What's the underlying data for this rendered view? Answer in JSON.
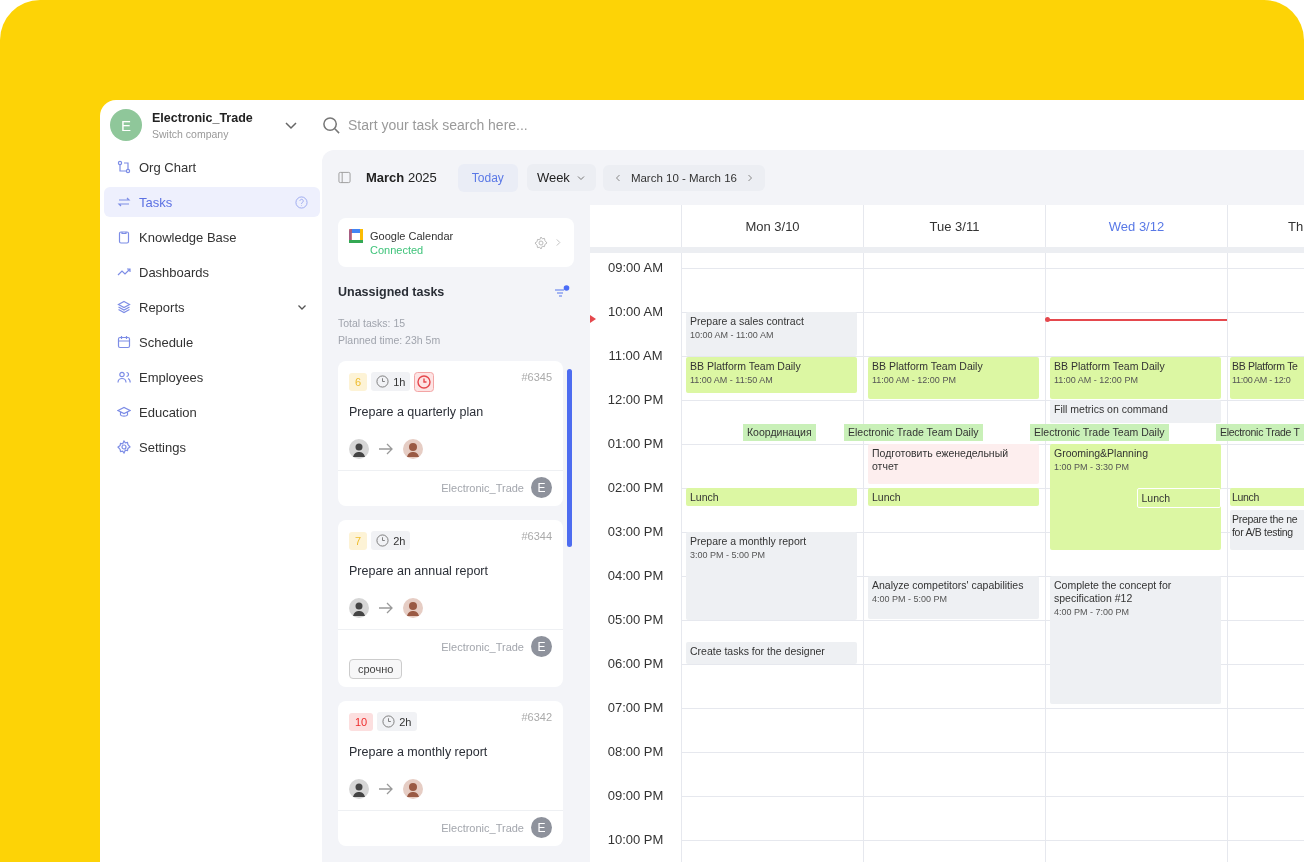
{
  "company": {
    "initial": "E",
    "name": "Electronic_Trade",
    "subtitle": "Switch company"
  },
  "nav": [
    {
      "label": "Org Chart",
      "kind": "org",
      "selected": false
    },
    {
      "label": "Tasks",
      "kind": "tasks",
      "selected": true,
      "help": true
    },
    {
      "label": "Knowledge Base",
      "kind": "book",
      "selected": false
    },
    {
      "label": "Dashboards",
      "kind": "trend",
      "selected": false
    },
    {
      "label": "Reports",
      "kind": "layers",
      "selected": false,
      "submenu": true
    },
    {
      "label": "Schedule",
      "kind": "calendar",
      "selected": false
    },
    {
      "label": "Employees",
      "kind": "people",
      "selected": false
    },
    {
      "label": "Education",
      "kind": "cap",
      "selected": false
    },
    {
      "label": "Settings",
      "kind": "gear",
      "selected": false
    }
  ],
  "search": {
    "placeholder": "Start your task search here..."
  },
  "toolbar": {
    "month": "**March** 2025",
    "today": "Today",
    "view": "Week",
    "range": "March 10 - March 16"
  },
  "integration": {
    "name": "Google Calendar",
    "status": "Connected"
  },
  "unassigned": {
    "title": "Unassigned tasks",
    "filter_active": true,
    "total": "Total tasks: 15",
    "planned": "Planned time: 23h 5m"
  },
  "tasks": [
    {
      "priority": "6",
      "color": "#fdf3d6",
      "duration": "1h",
      "overdue": true,
      "id": "#6345",
      "title": "Prepare a quarterly plan",
      "company": "Electronic_Trade",
      "company_initial": "E"
    },
    {
      "priority": "7",
      "color": "#fdf3d6",
      "duration": "2h",
      "overdue": false,
      "id": "#6344",
      "title": "Prepare an annual report",
      "company": "Electronic_Trade",
      "company_initial": "E",
      "tags": [
        "срочно"
      ]
    },
    {
      "priority": "10",
      "color": "#fcdfdf",
      "duration": "2h",
      "overdue": false,
      "id": "#6342",
      "title": "Prepare a monthly report",
      "company": "Electronic_Trade",
      "company_initial": "E"
    }
  ],
  "calendar": {
    "time_labels": [
      "09:00 AM",
      "10:00 AM",
      "11:00 AM",
      "12:00 PM",
      "01:00 PM",
      "02:00 PM",
      "03:00 PM",
      "04:00 PM",
      "05:00 PM",
      "06:00 PM",
      "07:00 PM",
      "08:00 PM",
      "09:00 PM",
      "10:00 PM"
    ],
    "days": [
      {
        "label": "Mon 3/10",
        "today": false,
        "events": [
          {
            "kind": "block",
            "title": "Prepare a sales contract",
            "time": "10:00 AM - 11:00 AM",
            "color": "#eef0f3"
          },
          {
            "kind": "block",
            "title": "BB Platform Team Daily",
            "time": "11:00 AM - 11:50 AM",
            "color": "#dcf7a3"
          },
          {
            "kind": "strip",
            "title": "Координация",
            "color": "#c9f0b8"
          },
          {
            "kind": "block",
            "title": "Lunch",
            "color": "#dcf7a3"
          },
          {
            "kind": "block",
            "title": "Prepare a monthly report",
            "time": "3:00 PM - 5:00 PM",
            "color": "#eef0f3"
          },
          {
            "kind": "block",
            "title": "Create tasks for the designer",
            "color": "#eef0f3"
          }
        ]
      },
      {
        "label": "Tue 3/11",
        "today": false,
        "events": [
          {
            "kind": "block",
            "title": "BB Platform Team Daily",
            "time": "11:00 AM - 12:00 PM",
            "color": "#dcf7a3"
          },
          {
            "kind": "strip",
            "title": "Electronic Trade Team Daily",
            "color": "#c9f0b8"
          },
          {
            "kind": "block",
            "title": "Подготовить еженедельный отчет",
            "color": "#fdeeee"
          },
          {
            "kind": "block",
            "title": "Lunch",
            "color": "#dcf7a3"
          },
          {
            "kind": "block",
            "title": "Analyze competitors' capabilities",
            "time": "4:00 PM - 5:00 PM",
            "color": "#eef0f3"
          }
        ]
      },
      {
        "label": "Wed 3/12",
        "today": true,
        "events": [
          {
            "kind": "block",
            "title": "BB Platform Team Daily",
            "time": "11:00 AM - 12:00 PM",
            "color": "#dcf7a3"
          },
          {
            "kind": "block",
            "title": "Fill metrics on command",
            "color": "#eef0f3"
          },
          {
            "kind": "strip",
            "title": "Electronic Trade Team Daily",
            "color": "#c9f0b8"
          },
          {
            "kind": "block",
            "title": "Grooming&Planning",
            "time": "1:00 PM - 3:30 PM",
            "color": "#dcf7a3"
          },
          {
            "kind": "block",
            "title": "Lunch",
            "color": "#dcf7a3",
            "overlap": true
          },
          {
            "kind": "block",
            "title": "Complete the concept for specification #12",
            "time": "4:00 PM - 7:00 PM",
            "color": "#eef0f3"
          }
        ]
      },
      {
        "label": "Th",
        "today": false,
        "events": [
          {
            "kind": "block",
            "title": "BB Platform Te",
            "time": "11:00 AM - 12:0",
            "color": "#dcf7a3"
          },
          {
            "kind": "strip",
            "title": "Electronic Trade T",
            "color": "#c9f0b8"
          },
          {
            "kind": "block",
            "title": "Lunch",
            "color": "#dcf7a3"
          },
          {
            "kind": "block",
            "title": "Prepare the ne\nfor A/B testing",
            "color": "#eef0f3"
          }
        ]
      }
    ]
  }
}
